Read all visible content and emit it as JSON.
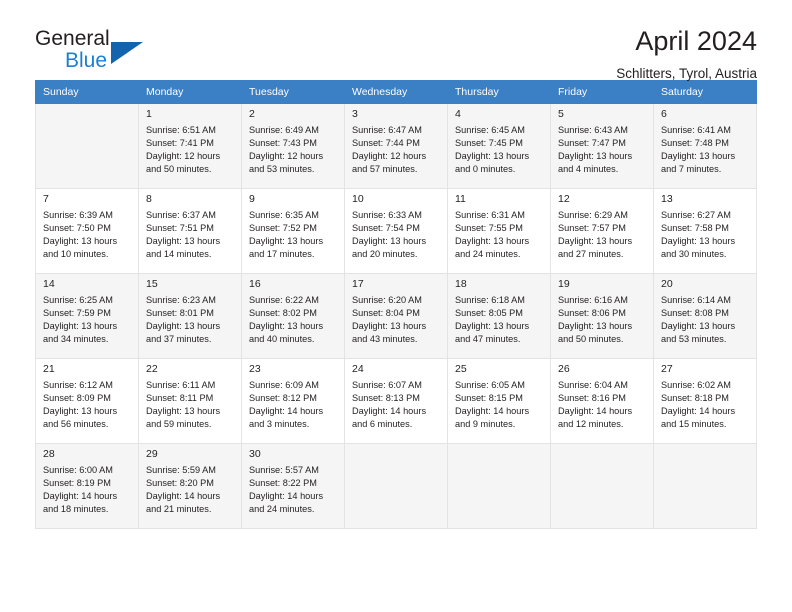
{
  "brand": {
    "name_top": "General",
    "name_bottom": "Blue"
  },
  "header": {
    "title": "April 2024",
    "subtitle": "Schlitters, Tyrol, Austria"
  },
  "colors": {
    "header_blue": "#3b7fc4",
    "brand_blue": "#1b7fd4",
    "triangle_blue": "#1464ad",
    "row_shade": "#f5f5f5",
    "text": "#231f20"
  },
  "labels": {
    "sunrise_prefix": "Sunrise:",
    "sunset_prefix": "Sunset:",
    "daylight_prefix": "Daylight:"
  },
  "weekdays": [
    "Sunday",
    "Monday",
    "Tuesday",
    "Wednesday",
    "Thursday",
    "Friday",
    "Saturday"
  ],
  "weeks": [
    [
      {
        "day": "",
        "sunrise": "",
        "sunset": "",
        "daylight_line1": "",
        "daylight_line2": "",
        "empty": true
      },
      {
        "day": "1",
        "sunrise": "Sunrise: 6:51 AM",
        "sunset": "Sunset: 7:41 PM",
        "daylight_line1": "Daylight: 12 hours",
        "daylight_line2": "and 50 minutes."
      },
      {
        "day": "2",
        "sunrise": "Sunrise: 6:49 AM",
        "sunset": "Sunset: 7:43 PM",
        "daylight_line1": "Daylight: 12 hours",
        "daylight_line2": "and 53 minutes."
      },
      {
        "day": "3",
        "sunrise": "Sunrise: 6:47 AM",
        "sunset": "Sunset: 7:44 PM",
        "daylight_line1": "Daylight: 12 hours",
        "daylight_line2": "and 57 minutes."
      },
      {
        "day": "4",
        "sunrise": "Sunrise: 6:45 AM",
        "sunset": "Sunset: 7:45 PM",
        "daylight_line1": "Daylight: 13 hours",
        "daylight_line2": "and 0 minutes."
      },
      {
        "day": "5",
        "sunrise": "Sunrise: 6:43 AM",
        "sunset": "Sunset: 7:47 PM",
        "daylight_line1": "Daylight: 13 hours",
        "daylight_line2": "and 4 minutes."
      },
      {
        "day": "6",
        "sunrise": "Sunrise: 6:41 AM",
        "sunset": "Sunset: 7:48 PM",
        "daylight_line1": "Daylight: 13 hours",
        "daylight_line2": "and 7 minutes."
      }
    ],
    [
      {
        "day": "7",
        "sunrise": "Sunrise: 6:39 AM",
        "sunset": "Sunset: 7:50 PM",
        "daylight_line1": "Daylight: 13 hours",
        "daylight_line2": "and 10 minutes."
      },
      {
        "day": "8",
        "sunrise": "Sunrise: 6:37 AM",
        "sunset": "Sunset: 7:51 PM",
        "daylight_line1": "Daylight: 13 hours",
        "daylight_line2": "and 14 minutes."
      },
      {
        "day": "9",
        "sunrise": "Sunrise: 6:35 AM",
        "sunset": "Sunset: 7:52 PM",
        "daylight_line1": "Daylight: 13 hours",
        "daylight_line2": "and 17 minutes."
      },
      {
        "day": "10",
        "sunrise": "Sunrise: 6:33 AM",
        "sunset": "Sunset: 7:54 PM",
        "daylight_line1": "Daylight: 13 hours",
        "daylight_line2": "and 20 minutes."
      },
      {
        "day": "11",
        "sunrise": "Sunrise: 6:31 AM",
        "sunset": "Sunset: 7:55 PM",
        "daylight_line1": "Daylight: 13 hours",
        "daylight_line2": "and 24 minutes."
      },
      {
        "day": "12",
        "sunrise": "Sunrise: 6:29 AM",
        "sunset": "Sunset: 7:57 PM",
        "daylight_line1": "Daylight: 13 hours",
        "daylight_line2": "and 27 minutes."
      },
      {
        "day": "13",
        "sunrise": "Sunrise: 6:27 AM",
        "sunset": "Sunset: 7:58 PM",
        "daylight_line1": "Daylight: 13 hours",
        "daylight_line2": "and 30 minutes."
      }
    ],
    [
      {
        "day": "14",
        "sunrise": "Sunrise: 6:25 AM",
        "sunset": "Sunset: 7:59 PM",
        "daylight_line1": "Daylight: 13 hours",
        "daylight_line2": "and 34 minutes."
      },
      {
        "day": "15",
        "sunrise": "Sunrise: 6:23 AM",
        "sunset": "Sunset: 8:01 PM",
        "daylight_line1": "Daylight: 13 hours",
        "daylight_line2": "and 37 minutes."
      },
      {
        "day": "16",
        "sunrise": "Sunrise: 6:22 AM",
        "sunset": "Sunset: 8:02 PM",
        "daylight_line1": "Daylight: 13 hours",
        "daylight_line2": "and 40 minutes."
      },
      {
        "day": "17",
        "sunrise": "Sunrise: 6:20 AM",
        "sunset": "Sunset: 8:04 PM",
        "daylight_line1": "Daylight: 13 hours",
        "daylight_line2": "and 43 minutes."
      },
      {
        "day": "18",
        "sunrise": "Sunrise: 6:18 AM",
        "sunset": "Sunset: 8:05 PM",
        "daylight_line1": "Daylight: 13 hours",
        "daylight_line2": "and 47 minutes."
      },
      {
        "day": "19",
        "sunrise": "Sunrise: 6:16 AM",
        "sunset": "Sunset: 8:06 PM",
        "daylight_line1": "Daylight: 13 hours",
        "daylight_line2": "and 50 minutes."
      },
      {
        "day": "20",
        "sunrise": "Sunrise: 6:14 AM",
        "sunset": "Sunset: 8:08 PM",
        "daylight_line1": "Daylight: 13 hours",
        "daylight_line2": "and 53 minutes."
      }
    ],
    [
      {
        "day": "21",
        "sunrise": "Sunrise: 6:12 AM",
        "sunset": "Sunset: 8:09 PM",
        "daylight_line1": "Daylight: 13 hours",
        "daylight_line2": "and 56 minutes."
      },
      {
        "day": "22",
        "sunrise": "Sunrise: 6:11 AM",
        "sunset": "Sunset: 8:11 PM",
        "daylight_line1": "Daylight: 13 hours",
        "daylight_line2": "and 59 minutes."
      },
      {
        "day": "23",
        "sunrise": "Sunrise: 6:09 AM",
        "sunset": "Sunset: 8:12 PM",
        "daylight_line1": "Daylight: 14 hours",
        "daylight_line2": "and 3 minutes."
      },
      {
        "day": "24",
        "sunrise": "Sunrise: 6:07 AM",
        "sunset": "Sunset: 8:13 PM",
        "daylight_line1": "Daylight: 14 hours",
        "daylight_line2": "and 6 minutes."
      },
      {
        "day": "25",
        "sunrise": "Sunrise: 6:05 AM",
        "sunset": "Sunset: 8:15 PM",
        "daylight_line1": "Daylight: 14 hours",
        "daylight_line2": "and 9 minutes."
      },
      {
        "day": "26",
        "sunrise": "Sunrise: 6:04 AM",
        "sunset": "Sunset: 8:16 PM",
        "daylight_line1": "Daylight: 14 hours",
        "daylight_line2": "and 12 minutes."
      },
      {
        "day": "27",
        "sunrise": "Sunrise: 6:02 AM",
        "sunset": "Sunset: 8:18 PM",
        "daylight_line1": "Daylight: 14 hours",
        "daylight_line2": "and 15 minutes."
      }
    ],
    [
      {
        "day": "28",
        "sunrise": "Sunrise: 6:00 AM",
        "sunset": "Sunset: 8:19 PM",
        "daylight_line1": "Daylight: 14 hours",
        "daylight_line2": "and 18 minutes."
      },
      {
        "day": "29",
        "sunrise": "Sunrise: 5:59 AM",
        "sunset": "Sunset: 8:20 PM",
        "daylight_line1": "Daylight: 14 hours",
        "daylight_line2": "and 21 minutes."
      },
      {
        "day": "30",
        "sunrise": "Sunrise: 5:57 AM",
        "sunset": "Sunset: 8:22 PM",
        "daylight_line1": "Daylight: 14 hours",
        "daylight_line2": "and 24 minutes."
      },
      {
        "day": "",
        "sunrise": "",
        "sunset": "",
        "daylight_line1": "",
        "daylight_line2": "",
        "empty": true
      },
      {
        "day": "",
        "sunrise": "",
        "sunset": "",
        "daylight_line1": "",
        "daylight_line2": "",
        "empty": true
      },
      {
        "day": "",
        "sunrise": "",
        "sunset": "",
        "daylight_line1": "",
        "daylight_line2": "",
        "empty": true
      },
      {
        "day": "",
        "sunrise": "",
        "sunset": "",
        "daylight_line1": "",
        "daylight_line2": "",
        "empty": true
      }
    ]
  ]
}
